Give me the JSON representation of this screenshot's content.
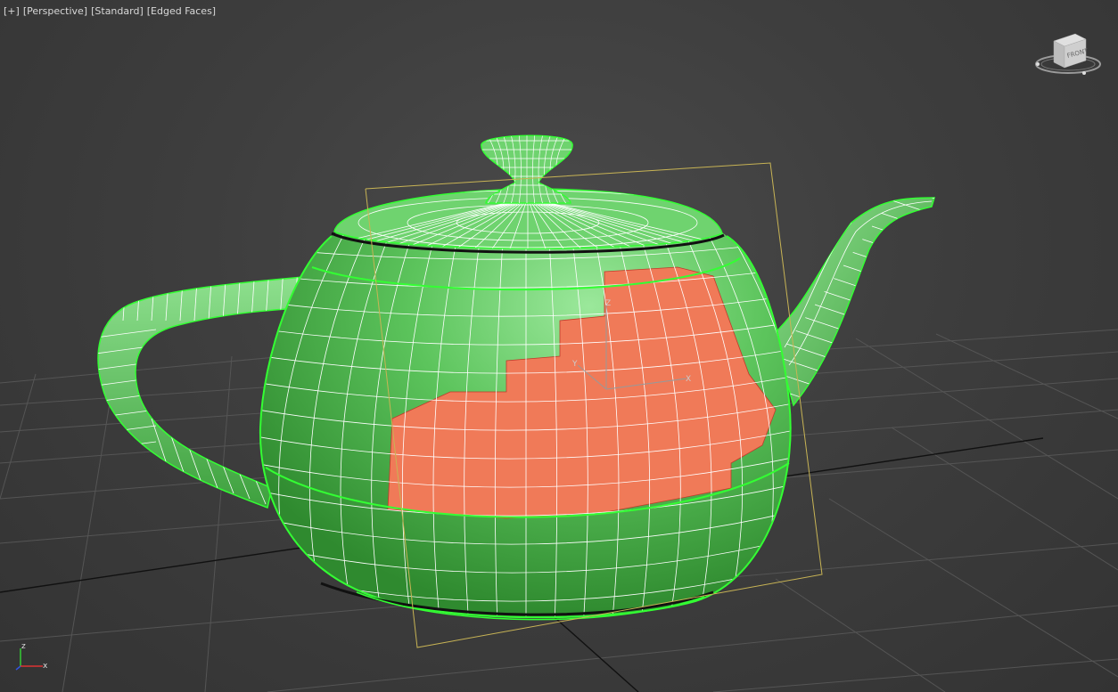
{
  "viewport": {
    "labels": [
      "[+]",
      "[Perspective]",
      "[Standard]",
      "[Edged Faces]"
    ],
    "viewcube_face": "FRONT",
    "axis_tripod": {
      "z": "z",
      "x": "x"
    },
    "gizmo": {
      "z": "Z",
      "y": "Y",
      "x": "X"
    }
  },
  "colors": {
    "background": "#3c3c3c",
    "object": "#5cbf5c",
    "object_highlight": "#8ee08e",
    "wireframe": "#ffffff",
    "selection_outline": "#33ff33",
    "selected_faces": "#f07a58",
    "bounding_box": "#c8b455",
    "grid": "#555555"
  },
  "icons": [
    "viewcube-icon",
    "axis-tripod-icon",
    "transform-gizmo-icon",
    "teapot-object"
  ]
}
